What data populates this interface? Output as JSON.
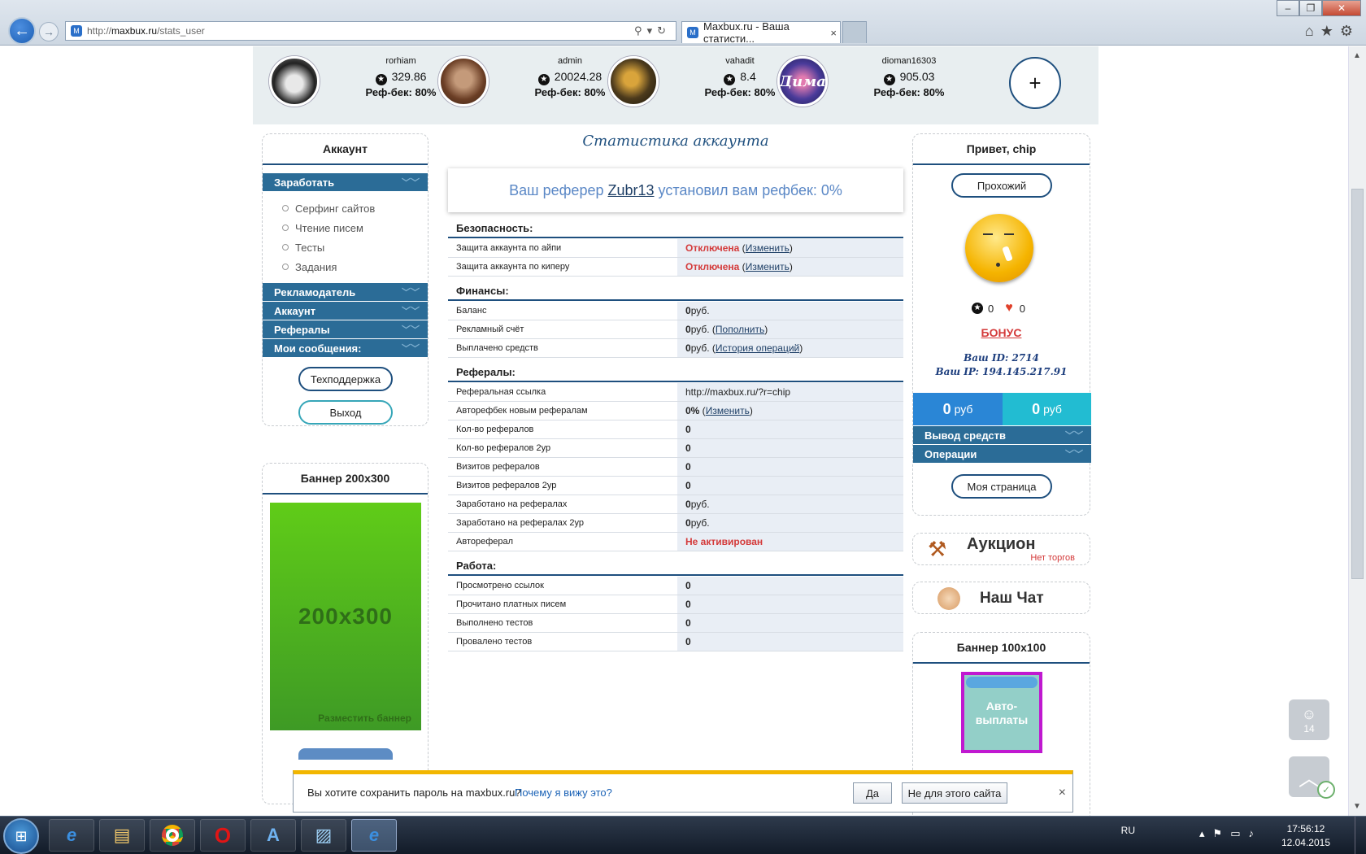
{
  "browser": {
    "url_prefix": "http://",
    "url_domain": "maxbux.ru",
    "url_path": "/stats_user",
    "tab_title": "Maxbux.ru - Ваша статисти...",
    "tab_close": "×",
    "favicon": "M"
  },
  "top_users": [
    {
      "name": "rorhiam",
      "points": "329.86",
      "refback": "Реф-бек: 80%"
    },
    {
      "name": "admin",
      "points": "20024.28",
      "refback": "Реф-бек: 80%"
    },
    {
      "name": "vahadit",
      "points": "8.4",
      "refback": "Реф-бек: 80%"
    },
    {
      "name": "dioman16303",
      "points": "905.03",
      "refback": "Реф-бек: 80%",
      "avatar_text": "Дима"
    }
  ],
  "plus_label": "+",
  "left_panel": {
    "title": "Аккаунт",
    "earn_head": "Заработать",
    "earn_items": [
      "Серфинг сайтов",
      "Чтение писем",
      "Тесты",
      "Задания"
    ],
    "menus": [
      "Рекламодатель",
      "Аккаунт",
      "Рефералы",
      "Мои сообщения:"
    ],
    "support_btn": "Техподдержка",
    "logout_btn": "Выход"
  },
  "banner_left": {
    "title": "Баннер 200x300",
    "text": "200x300",
    "place": "Разместить баннер"
  },
  "center": {
    "title": "Статистика аккаунта",
    "ref_prefix": "Ваш реферер",
    "ref_name": "Zubr13",
    "ref_suffix": "установил вам рефбек: 0%",
    "sections": {
      "security": "Безопасность:",
      "finance": "Финансы:",
      "referrals": "Рефералы:",
      "work": "Работа:"
    },
    "security_rows": [
      {
        "label": "Защита аккаунта по айпи",
        "status": "Отключена",
        "link": "Изменить"
      },
      {
        "label": "Защита аккаунта по киперу",
        "status": "Отключена",
        "link": "Изменить"
      }
    ],
    "finance_rows": [
      {
        "label": "Баланс",
        "value": "0",
        "unit": " руб.",
        "link": ""
      },
      {
        "label": "Рекламный счёт",
        "value": "0",
        "unit": " руб.",
        "link": "Пополнить"
      },
      {
        "label": "Выплачено средств",
        "value": "0",
        "unit": " руб.",
        "link": "История операций"
      }
    ],
    "ref_link_label": "Реферальная ссылка",
    "ref_link_value": "http://maxbux.ru/?r=chip",
    "autorefback_label": "Авторефбек новым рефералам",
    "autorefback_value": "0%",
    "autorefback_link": "Изменить",
    "referral_rows": [
      {
        "label": "Кол-во рефералов",
        "value": "0",
        "unit": ""
      },
      {
        "label": "Кол-во рефералов 2ур",
        "value": "0",
        "unit": ""
      },
      {
        "label": "Визитов рефералов",
        "value": "0",
        "unit": ""
      },
      {
        "label": "Визитов рефералов 2ур",
        "value": "0",
        "unit": ""
      },
      {
        "label": "Заработано на рефералах",
        "value": "0",
        "unit": " руб."
      },
      {
        "label": "Заработано на рефералах 2ур",
        "value": "0",
        "unit": " руб."
      }
    ],
    "autoref_label": "Автореферал",
    "autoref_value": "Не активирован",
    "work_rows": [
      {
        "label": "Просмотрено ссылок",
        "value": "0"
      },
      {
        "label": "Прочитано платных писем",
        "value": "0"
      },
      {
        "label": "Выполнено тестов",
        "value": "0"
      },
      {
        "label": "Провалено тестов",
        "value": "0"
      }
    ]
  },
  "right_panel": {
    "greeting": "Привет, chip",
    "status_btn": "Прохожий",
    "stars": "0",
    "hearts": "0",
    "bonus": "БОНУС",
    "user_id": "Ваш ID: 2714",
    "user_ip": "Ваш IP: 194.145.217.91",
    "balance1": "0",
    "balance2": "0",
    "currency": "руб",
    "menus": [
      "Вывод средств",
      "Операции"
    ],
    "my_page_btn": "Моя страница",
    "auction_title": "Аукцион",
    "auction_sub": "Нет торгов",
    "chat_title": "Наш Чат",
    "banner_title": "Баннер 100x100",
    "banner_text": "Авто-\nвыплаты"
  },
  "float": {
    "count": "14"
  },
  "password_bar": {
    "message": "Вы хотите сохранить пароль на maxbux.ru?",
    "why": "Почему я вижу это?",
    "yes": "Да",
    "no": "Не для этого сайта",
    "close": "×"
  },
  "taskbar": {
    "lang": "RU",
    "time": "17:56:12",
    "date": "12.04.2015"
  },
  "colors": {
    "accent_dark": "#1e4f7e",
    "menu_blue": "#2b6c97",
    "status_red": "#d43a3a",
    "money_blue": "#2a86d6",
    "money_teal": "#22bcd2"
  }
}
